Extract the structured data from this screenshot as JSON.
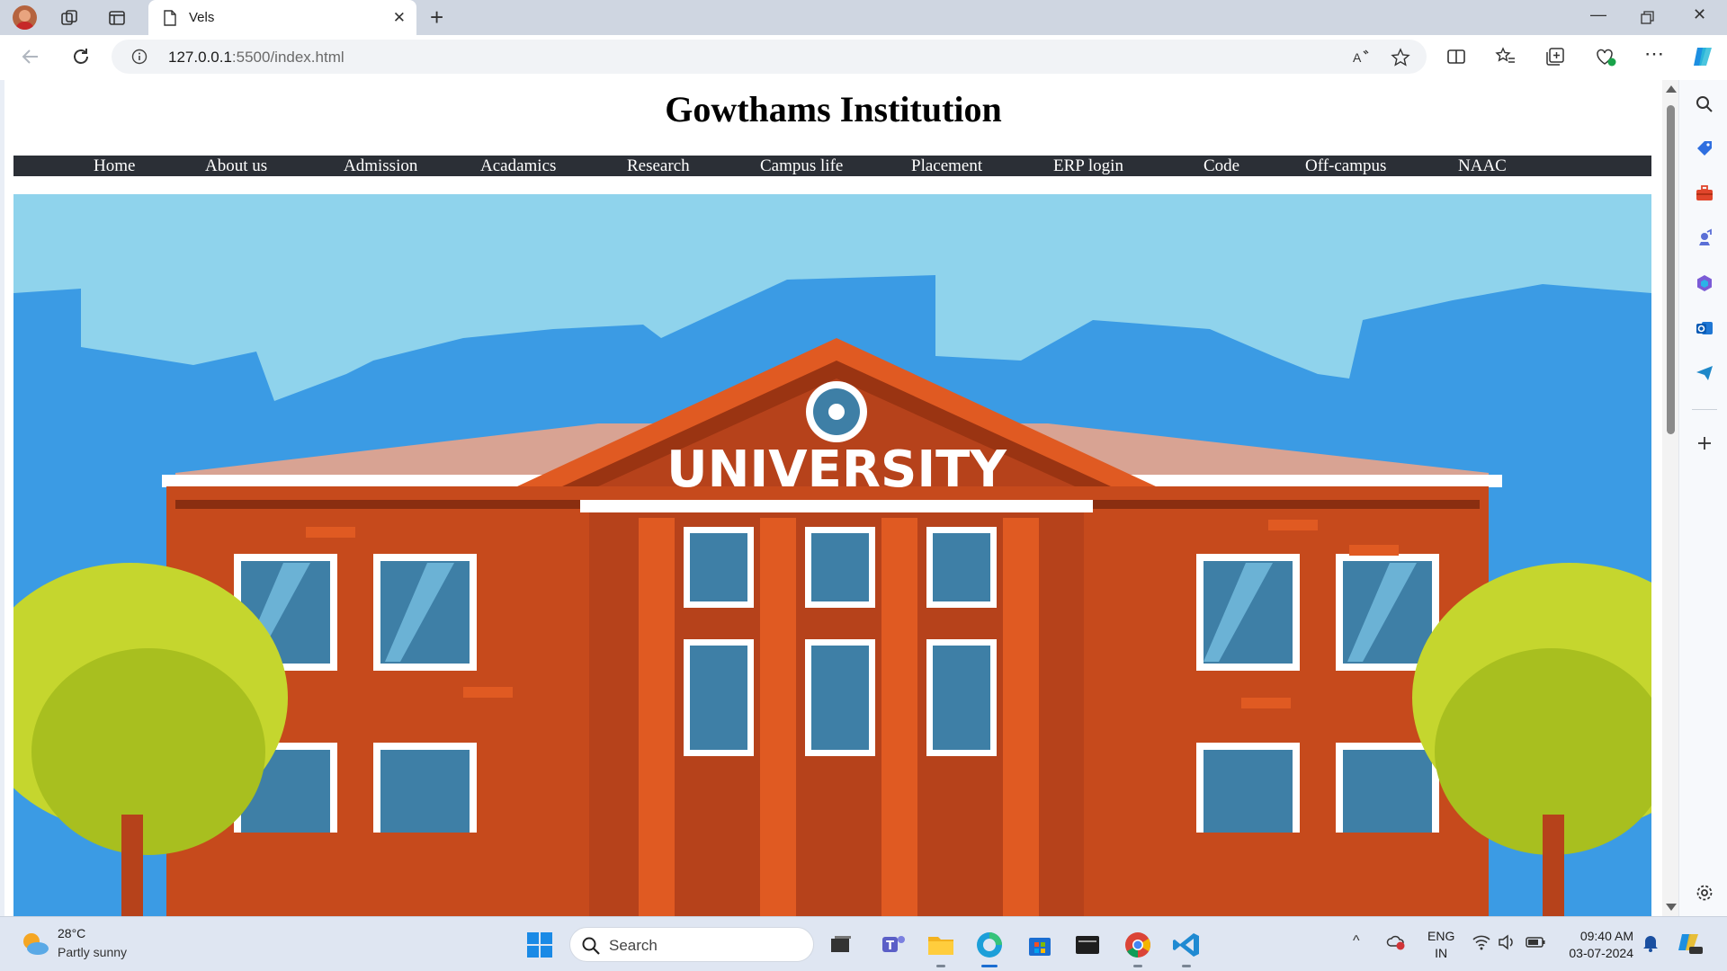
{
  "browser": {
    "tab_title": "Vels",
    "url_host": "127.0.0.1",
    "url_rest": ":5500/index.html"
  },
  "page": {
    "title": "Gowthams Institution",
    "nav": [
      "Home",
      "About us",
      "Admission",
      "Acadamics",
      "Research",
      "Campus life",
      "Placement",
      "ERP login",
      "Code",
      "Off-campus",
      "NAAC"
    ],
    "hero": {
      "sign_text": "UNIVERSITY",
      "colors": {
        "sky": "#8fd3ec",
        "skyline": "#3b9be4",
        "brick": "#c64a1c",
        "brick_light": "#e05a22",
        "roof": "#d8a393",
        "window": "#3e7fa6",
        "tree": "#c5d62e"
      }
    }
  },
  "taskbar": {
    "weather_temp": "28°C",
    "weather_desc": "Partly sunny",
    "search_label": "Search",
    "lang_line1": "ENG",
    "lang_line2": "IN",
    "time": "09:40 AM",
    "date": "03-07-2024"
  }
}
